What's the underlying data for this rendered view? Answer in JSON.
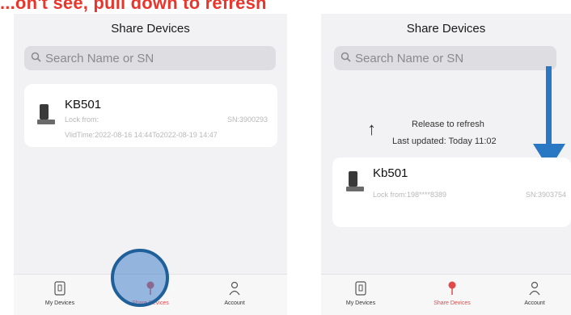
{
  "caption": "...on't see, pull down to refresh",
  "left_screen": {
    "title": "Share Devices",
    "search_placeholder": "Search Name or SN",
    "device": {
      "name": "KB501",
      "lock_from": "Lock from:",
      "sn": "SN:3900293",
      "valid_time": "VlidTime:2022-08-16 14:44To2022-08-19 14:47"
    },
    "tabs": [
      {
        "label": "My Devices",
        "icon": "my-devices-icon"
      },
      {
        "label": "Share Devices",
        "icon": "share-devices-icon"
      },
      {
        "label": "Account",
        "icon": "account-icon"
      }
    ]
  },
  "right_screen": {
    "title": "Share Devices",
    "search_placeholder": "Search Name or SN",
    "refresh_title": "Release to refresh",
    "refresh_time": "Last updated: Today 11:02",
    "device": {
      "name": "Kb501",
      "lock_from": "Lock from:198****8389",
      "sn": "SN:3903754"
    },
    "tabs": [
      {
        "label": "My Devices",
        "icon": "my-devices-icon"
      },
      {
        "label": "Share Devices",
        "icon": "share-devices-icon"
      },
      {
        "label": "Account",
        "icon": "account-icon"
      }
    ]
  },
  "colors": {
    "caption": "#e8362c",
    "active_tab": "#e04a4a",
    "annotation_blue": "#2a78c4"
  }
}
